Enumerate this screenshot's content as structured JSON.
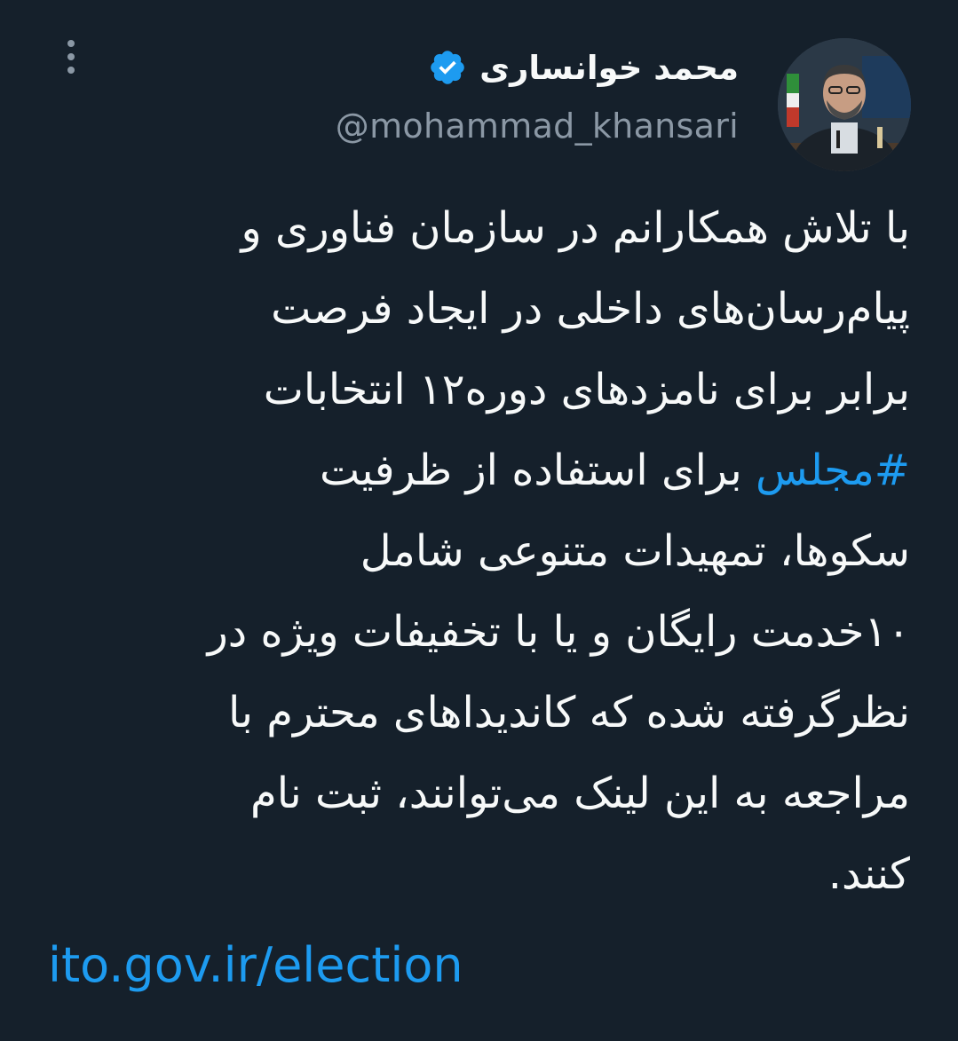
{
  "author": {
    "display_name": "محمد خوانساری",
    "handle": "@mohammad_khansari",
    "verified": true,
    "avatar": "profile-photo"
  },
  "menu": {
    "icon": "more-vertical-icon"
  },
  "tweet": {
    "lines": [
      {
        "text": "با تلاش همکارانم در سازمان فناوری و"
      },
      {
        "text": "پیام‌رسان‌های داخلی در ایجاد فرصت"
      },
      {
        "text": "برابر برای نامزدهای دوره۱۲ انتخابات"
      },
      {
        "hashtag": "#مجلس",
        "text": " برای استفاده از ظرفیت"
      },
      {
        "text": "سکوها، تمهیدات متنوعی شامل"
      },
      {
        "text": "۱۰خدمت رایگان و یا با تخفیفات ویژه در"
      },
      {
        "text": "نظرگرفته شده که کاندیداهای محترم با"
      },
      {
        "text": "مراجعه به این لینک می‌توانند، ثبت نام"
      },
      {
        "text": "کنند."
      }
    ],
    "link": "ito.gov.ir/election"
  },
  "colors": {
    "background": "#15202b",
    "text": "#f7f9f9",
    "secondary_text": "#8b98a5",
    "accent": "#1d9bf0"
  }
}
